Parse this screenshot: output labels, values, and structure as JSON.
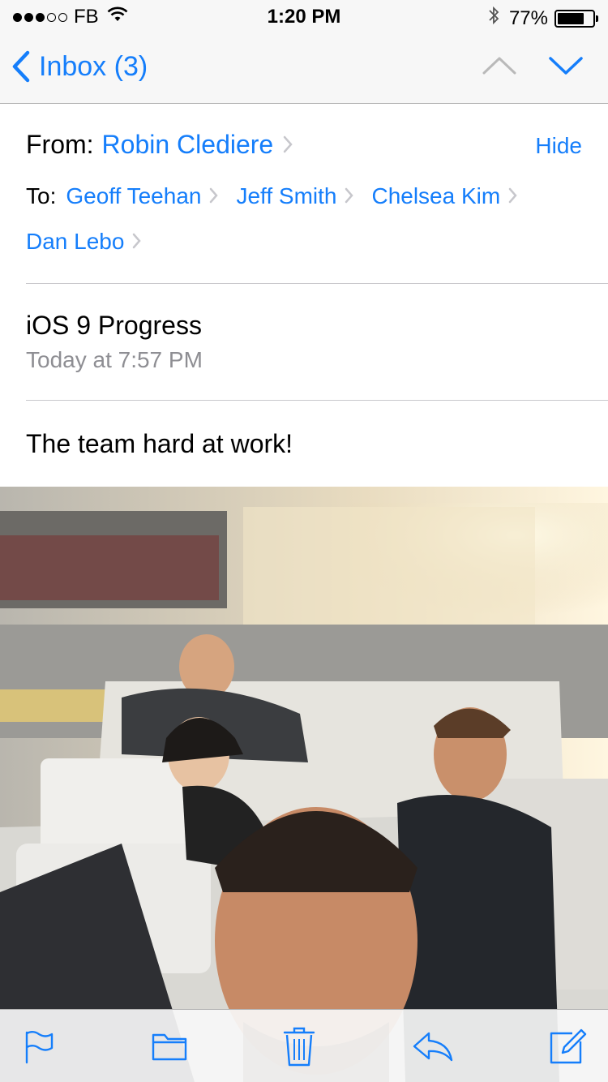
{
  "status_bar": {
    "signal_filled": 3,
    "signal_total": 5,
    "carrier": "FB",
    "time": "1:20 PM",
    "battery_text": "77%",
    "battery_level": 0.77
  },
  "nav": {
    "back_label": "Inbox (3)",
    "icons": [
      "chevron-left-icon",
      "chevron-up-icon",
      "chevron-down-icon"
    ]
  },
  "header": {
    "from_label": "From:",
    "from_name": "Robin Clediere",
    "hide_label": "Hide",
    "to_label": "To:",
    "recipients": [
      "Geoff Teehan",
      "Jeff Smith",
      "Chelsea Kim",
      "Dan Lebo"
    ]
  },
  "message": {
    "subject": "iOS 9 Progress",
    "date": "Today at 7:57 PM",
    "body": "The team hard at work!"
  },
  "toolbar": {
    "icons": [
      "flag-icon",
      "folder-icon",
      "trash-icon",
      "reply-icon",
      "compose-icon"
    ]
  },
  "colors": {
    "accent": "#157efb",
    "secondary_text": "#8e8e93",
    "bar_background": "#f7f7f7"
  }
}
